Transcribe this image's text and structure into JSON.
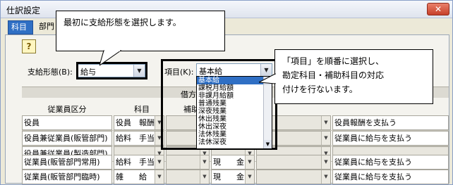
{
  "window": {
    "title": "仕訳設定",
    "close_label": "✕"
  },
  "tabs": [
    {
      "label": "科目"
    },
    {
      "label": "部門"
    }
  ],
  "help_icon_glyph": "?",
  "form": {
    "shikyu_label": "支給形態(B):",
    "shikyu_value": "給与",
    "koumoku_label": "項目(K):",
    "koumoku_value": "基本給"
  },
  "dropdown_options": [
    "基本給",
    "課税月給額",
    "非課月給額",
    "普通残業",
    "深夜残業",
    "休出残業",
    "休出深夜",
    "法休残業",
    "法休深夜"
  ],
  "dropdown_selected_index": 0,
  "table": {
    "header_kashikata": "借方",
    "header_employee": "従業員区分",
    "header_kamoku": "科目",
    "header_hojo": "補助",
    "rows": [
      {
        "name": "役員",
        "debit": "役員　報酬",
        "credit": "",
        "desc": "役員報酬を支払う"
      },
      {
        "name": "役員兼従業員(販管部門)",
        "debit": "給料　手当",
        "credit": "",
        "desc": "従業員に給与を支払う"
      },
      {
        "name": "役員兼従業員(製造部門)",
        "debit": "",
        "credit": "",
        "desc": ""
      },
      {
        "name": "従業員(販管部門常用)",
        "debit": "給料　手当",
        "credit": "現　　金",
        "desc": "従業員に給与を支払う"
      },
      {
        "name": "従業員(販管部門臨時)",
        "debit": "雑　　給",
        "credit": "現　　金",
        "desc": "従業員に給与を支払う"
      }
    ]
  },
  "callouts": {
    "first": "最初に支給形態を選択します。",
    "second_line1": "「項目」を順番に選択し、",
    "second_line2": "勘定科目・補助科目の対応",
    "second_line3": "付けを行ないます。"
  }
}
